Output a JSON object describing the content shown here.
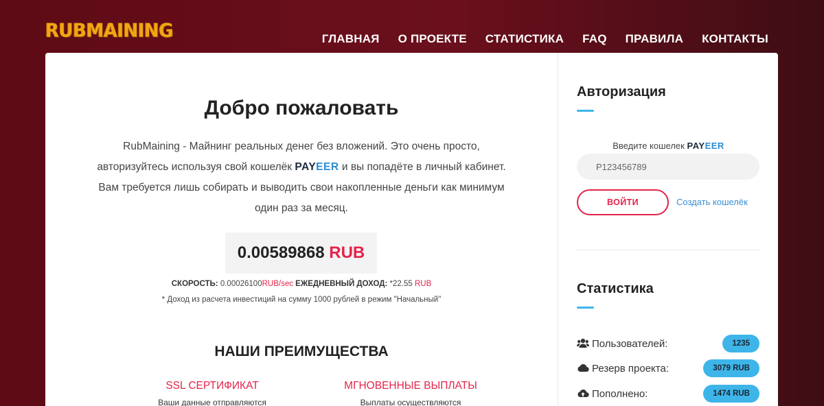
{
  "header": {
    "logo": "RUBMAINING",
    "nav": [
      "ГЛАВНАЯ",
      "О ПРОЕКТЕ",
      "СТАТИСТИКА",
      "FAQ",
      "ПРАВИЛА",
      "КОНТАКТЫ"
    ]
  },
  "main": {
    "welcome_title": "Добро пожаловать",
    "intro_part1": "RubMaining - Майнинг реальных денег без вложений. Это очень просто, авторизуйтесь используя свой кошелёк",
    "intro_pay": "PAY",
    "intro_eer": "EER",
    "intro_part2": "и вы попадёте в личный кабинет. Вам требуется лишь собирать и выводить свои накопленные деньги как минимум один раз за месяц.",
    "balance_value": "0.00589868",
    "balance_currency": "RUB",
    "speed_label": "СКОРОСТЬ:",
    "speed_value": "0.00026100",
    "speed_unit": "RUB/sec",
    "daily_label": "ЕЖЕДНЕВНЫЙ ДОХОД:",
    "daily_value": "*22.55",
    "daily_unit": "RUB",
    "note": "* Доход из расчета инвестиций на сумму 1000 рублей в режим \"Начальный\"",
    "advantages_title": "НАШИ ПРЕИМУЩЕСТВА",
    "features": [
      {
        "title": "SSL СЕРТИФИКАТ",
        "desc": "Ваши данные отправляются"
      },
      {
        "title": "МГНОВЕННЫЕ ВЫПЛАТЫ",
        "desc": "Выплаты осуществляются"
      }
    ]
  },
  "sidebar": {
    "auth_title": "Авторизация",
    "wallet_label": "Введите кошелек",
    "wallet_pay": "PAY",
    "wallet_eer": "EER",
    "wallet_placeholder": "P123456789",
    "login_button": "ВОЙТИ",
    "create_wallet": "Создать кошелёк",
    "stats_title": "Статистика",
    "stats": [
      {
        "icon": "users-icon",
        "label": "Пользователей:",
        "value": "1235"
      },
      {
        "icon": "cloud-icon",
        "label": "Резерв проекта:",
        "value": "3079 RUB"
      },
      {
        "icon": "cloud-upload-icon",
        "label": "Пополнено:",
        "value": "1474 RUB"
      }
    ]
  },
  "colors": {
    "background": "#6b0f1c",
    "accent_red": "#e5234a",
    "accent_blue": "#3eb5e8",
    "logo": "#f2a516"
  }
}
